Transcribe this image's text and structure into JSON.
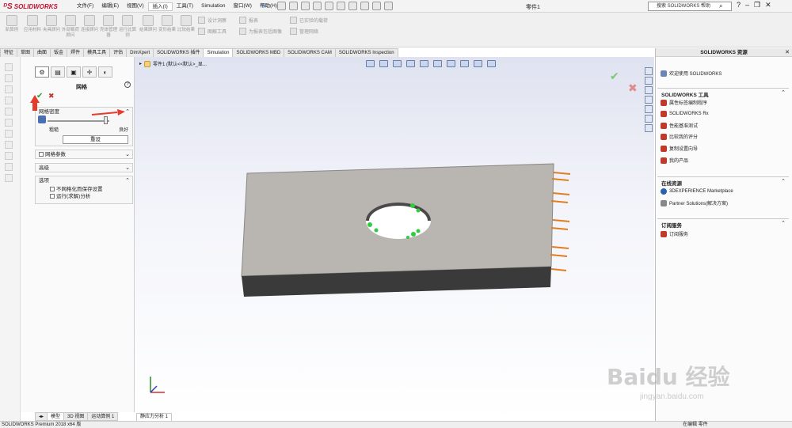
{
  "app": {
    "logo_text": "SOLIDWORKS",
    "document_title": "零件1",
    "help_search_placeholder": "搜索 SOLIDWORKS 帮助",
    "status_text": "SOLIDWORKS Premium 2018 x64 版",
    "status_right": "在编辑 零件"
  },
  "menu": [
    "文件(F)",
    "编辑(E)",
    "视图(V)",
    "插入(I)",
    "工具(T)",
    "Simulation",
    "窗口(W)",
    "帮助(H)"
  ],
  "command_manager": {
    "large": [
      "新算例",
      "应用材料",
      "夹具顾问",
      "外部载荷顾问",
      "连接顾问",
      "壳体管理器",
      "运行此算例",
      "结果顾问",
      "变形结果",
      "比较结果"
    ],
    "small": [
      "设计洞察",
      "图解工具",
      "报表",
      "为报表包括图像",
      "已实验的载荷",
      "管理网络"
    ]
  },
  "tabs": [
    "特征",
    "草图",
    "曲面",
    "钣金",
    "焊件",
    "模具工具",
    "评估",
    "DimXpert",
    "SOLIDWORKS 插件",
    "Simulation",
    "SOLIDWORKS MBD",
    "SOLIDWORKS CAM",
    "SOLIDWORKS Inspection"
  ],
  "property_manager": {
    "title": "网格",
    "help": "?",
    "mesh_density_header": "网格密度",
    "coarse_label": "粗糙",
    "fine_label": "良好",
    "reset_label": "重设",
    "mesh_params_label": "网格参数",
    "advanced_label": "高级",
    "options_label": "选项",
    "option1": "不网格化而保存设置",
    "option2": "运行(求解)分析"
  },
  "bottom_tabs": [
    "模型",
    "3D 视图",
    "运动算例 1"
  ],
  "viewport": {
    "breadcrumb": "零件1 (默认<<默认>_显...",
    "study_tab": "静应力分析 1"
  },
  "task_pane": {
    "title": "SOLIDWORKS 资源",
    "welcome": "欢迎使用 SOLIDWORKS",
    "tools_header": "SOLIDWORKS 工具",
    "tools": [
      "属性标签编制程序",
      "SOLIDWORKS Rx",
      "性能基准测试",
      "比较我的评分",
      "复制设置向导",
      "我的产品"
    ],
    "online_header": "在线资源",
    "online": [
      "3DEXPERIENCE Marketplace",
      "Partner Solutions(解决方案)"
    ],
    "subscription_header": "订阅服务",
    "subscription": [
      "订阅服务"
    ]
  },
  "watermark": {
    "main": "Baidu 经验",
    "sub": "jingyan.baidu.com"
  },
  "colors": {
    "solidworks_red": "#c8102e",
    "annotation_red": "#e53b2c",
    "ok_green": "#2e9b2e"
  }
}
